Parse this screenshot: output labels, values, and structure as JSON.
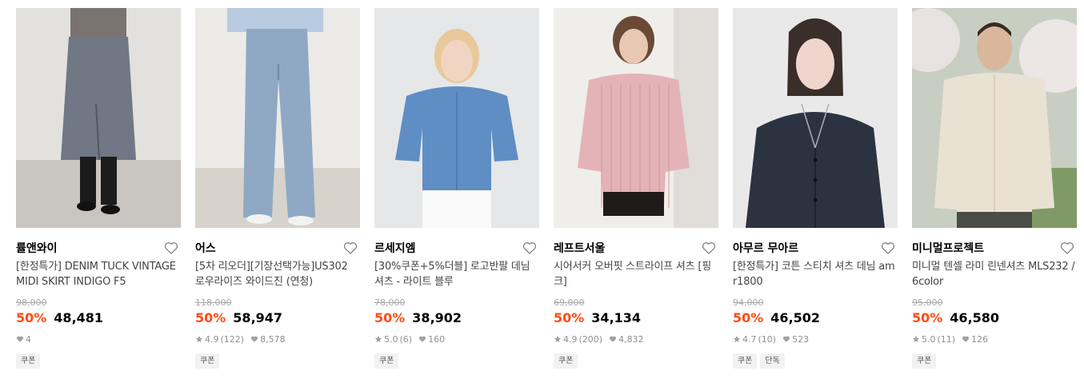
{
  "products": [
    {
      "brand": "률앤와이",
      "title": "[한정특가] DENIM TUCK VINTAGE MIDI SKIRT INDIGO F5",
      "original_price": "98,000",
      "discount": "50%",
      "price": "48,481",
      "rating": "",
      "reviews": "",
      "likes": "4",
      "tags": [
        "쿠폰"
      ],
      "image_alt": "denim midi skirt with black boots"
    },
    {
      "brand": "어스",
      "title": "[5차 리오더][기장선택가능]US302 로우라이즈 와이드진 (연청)",
      "original_price": "118,000",
      "discount": "50%",
      "price": "58,947",
      "rating": "4.9",
      "reviews": "(122)",
      "likes": "8,578",
      "tags": [
        "쿠폰"
      ],
      "image_alt": "light wash wide jeans with sneakers"
    },
    {
      "brand": "르세지엠",
      "title": "[30%쿠폰+5%더블] 로고반팔 데님셔츠 - 라이트 블루",
      "original_price": "78,000",
      "discount": "50%",
      "price": "38,902",
      "rating": "5.0",
      "reviews": "(6)",
      "likes": "160",
      "tags": [
        "쿠폰"
      ],
      "image_alt": "light blue short sleeve denim shirt"
    },
    {
      "brand": "레프트서울",
      "title": "시어서커 오버핏 스트라이프 셔츠 [핑크]",
      "original_price": "69,000",
      "discount": "50%",
      "price": "34,134",
      "rating": "4.9",
      "reviews": "(200)",
      "likes": "4,832",
      "tags": [
        "쿠폰"
      ],
      "image_alt": "pink striped oversized shirt"
    },
    {
      "brand": "아무르 무아르",
      "title": "[한정특가] 코튼 스티치 셔츠 데님 amr1800",
      "original_price": "94,000",
      "discount": "50%",
      "price": "46,502",
      "rating": "4.7",
      "reviews": "(10)",
      "likes": "523",
      "tags": [
        "쿠폰",
        "단독"
      ],
      "image_alt": "dark denim stitch shirt"
    },
    {
      "brand": "미니멀프로젝트",
      "title": "미니멀 텐셀 라미 린넨셔츠 MLS232 / 6color",
      "original_price": "95,000",
      "discount": "50%",
      "price": "46,580",
      "rating": "5.0",
      "reviews": "(11)",
      "likes": "126",
      "tags": [
        "쿠폰"
      ],
      "image_alt": "beige linen shirt outdoors"
    }
  ],
  "colors": {
    "discount": "#ff4b15",
    "price": "#000000",
    "muted": "#909090"
  }
}
